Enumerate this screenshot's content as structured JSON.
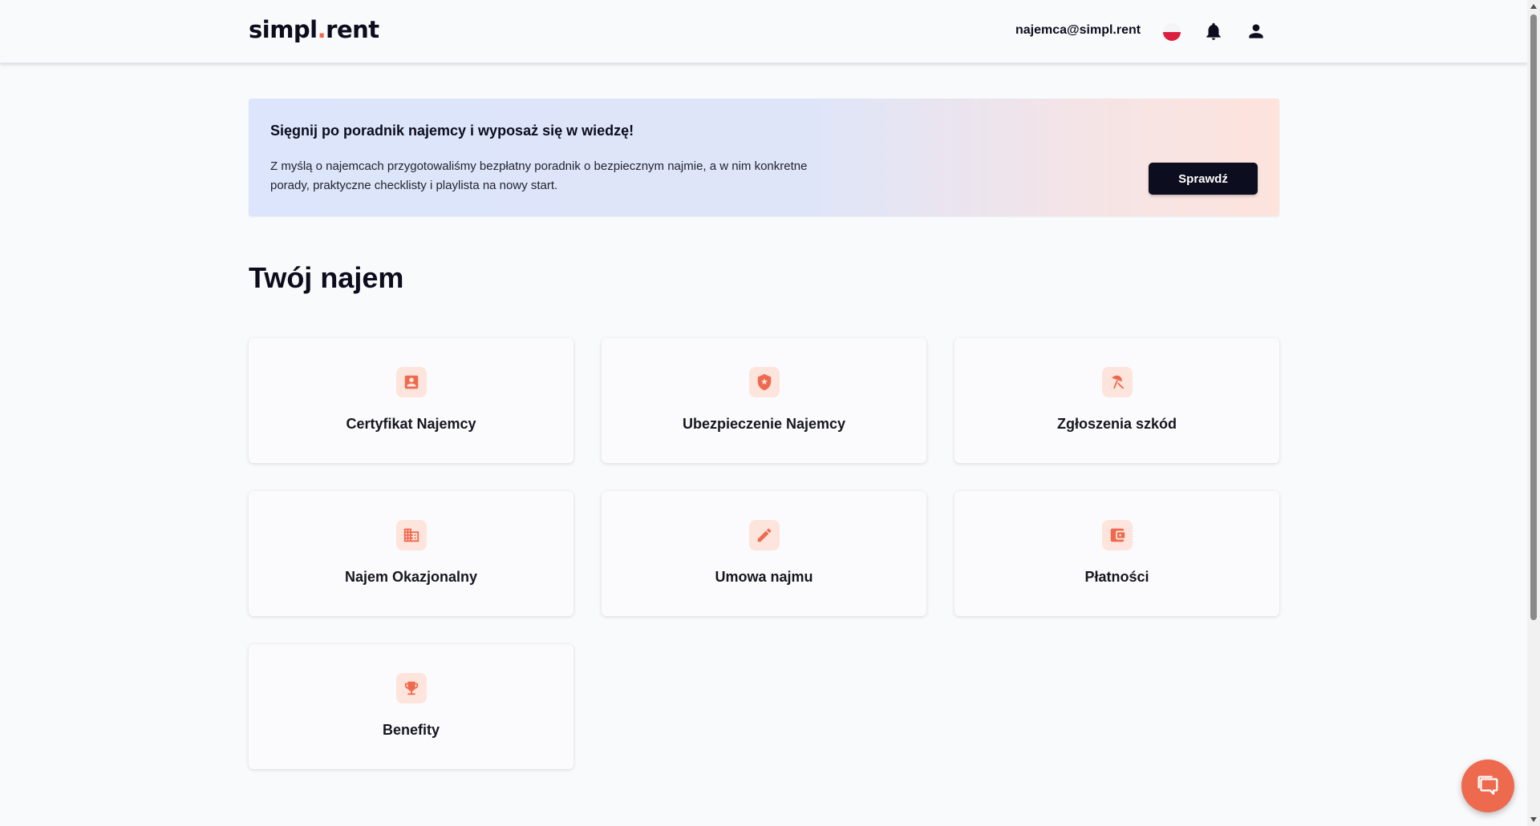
{
  "header": {
    "logo_part1": "simpl",
    "logo_dot": ".",
    "logo_part2": "rent",
    "user_email": "najemca@simpl.rent",
    "language_flag": "pl-flag-icon"
  },
  "banner": {
    "title": "Sięgnij po poradnik najemcy i wyposaż się w wiedzę!",
    "text_line1": "Z myślą o najemcach przygotowaliśmy bezpłatny poradnik o bezpiecznym najmie, a w nim konkretne",
    "text_line2": "porady, praktyczne checklisty i playlista na nowy start.",
    "button_label": "Sprawdź"
  },
  "section": {
    "title": "Twój najem"
  },
  "tiles": [
    {
      "label": "Certyfikat Najemcy",
      "icon": "badge-icon"
    },
    {
      "label": "Ubezpieczenie Najemcy",
      "icon": "shield-star-icon"
    },
    {
      "label": "Zgłoszenia szkód",
      "icon": "umbrella-icon"
    },
    {
      "label": "Najem Okazjonalny",
      "icon": "building-icon"
    },
    {
      "label": "Umowa najmu",
      "icon": "pencil-icon"
    },
    {
      "label": "Płatności",
      "icon": "wallet-icon"
    },
    {
      "label": "Benefity",
      "icon": "trophy-icon"
    }
  ],
  "colors": {
    "accent": "#ee6a4f",
    "icon_bg": "#fde4dc",
    "dark": "#0c0d1e",
    "background": "#f9fafc"
  }
}
